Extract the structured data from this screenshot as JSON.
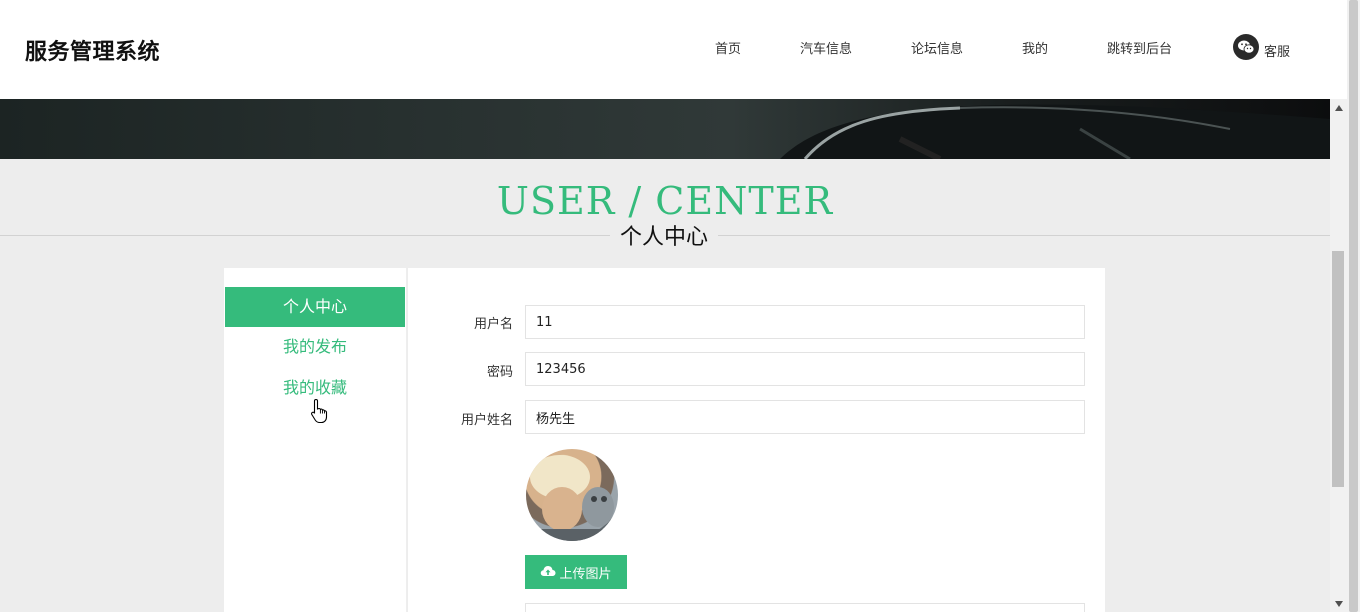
{
  "header": {
    "logo": "服务管理系统",
    "nav": [
      {
        "label": "首页"
      },
      {
        "label": "汽车信息"
      },
      {
        "label": "论坛信息"
      },
      {
        "label": "我的"
      },
      {
        "label": "跳转到后台"
      }
    ],
    "service": {
      "icon": "wechat-icon",
      "label": "客服"
    }
  },
  "section": {
    "title_en": "USER / CENTER",
    "title_cn": "个人中心"
  },
  "sidebar": {
    "items": [
      {
        "label": "个人中心",
        "active": true
      },
      {
        "label": "我的发布",
        "active": false
      },
      {
        "label": "我的收藏",
        "active": false
      }
    ]
  },
  "form": {
    "fields": [
      {
        "label": "用户名",
        "value": "11"
      },
      {
        "label": "密码",
        "value": "123456"
      },
      {
        "label": "用户姓名",
        "value": "杨先生"
      }
    ],
    "upload_label": "上传图片",
    "upload_icon": "cloud-upload-icon"
  },
  "colors": {
    "accent": "#35bb7c",
    "background": "#ededed"
  }
}
